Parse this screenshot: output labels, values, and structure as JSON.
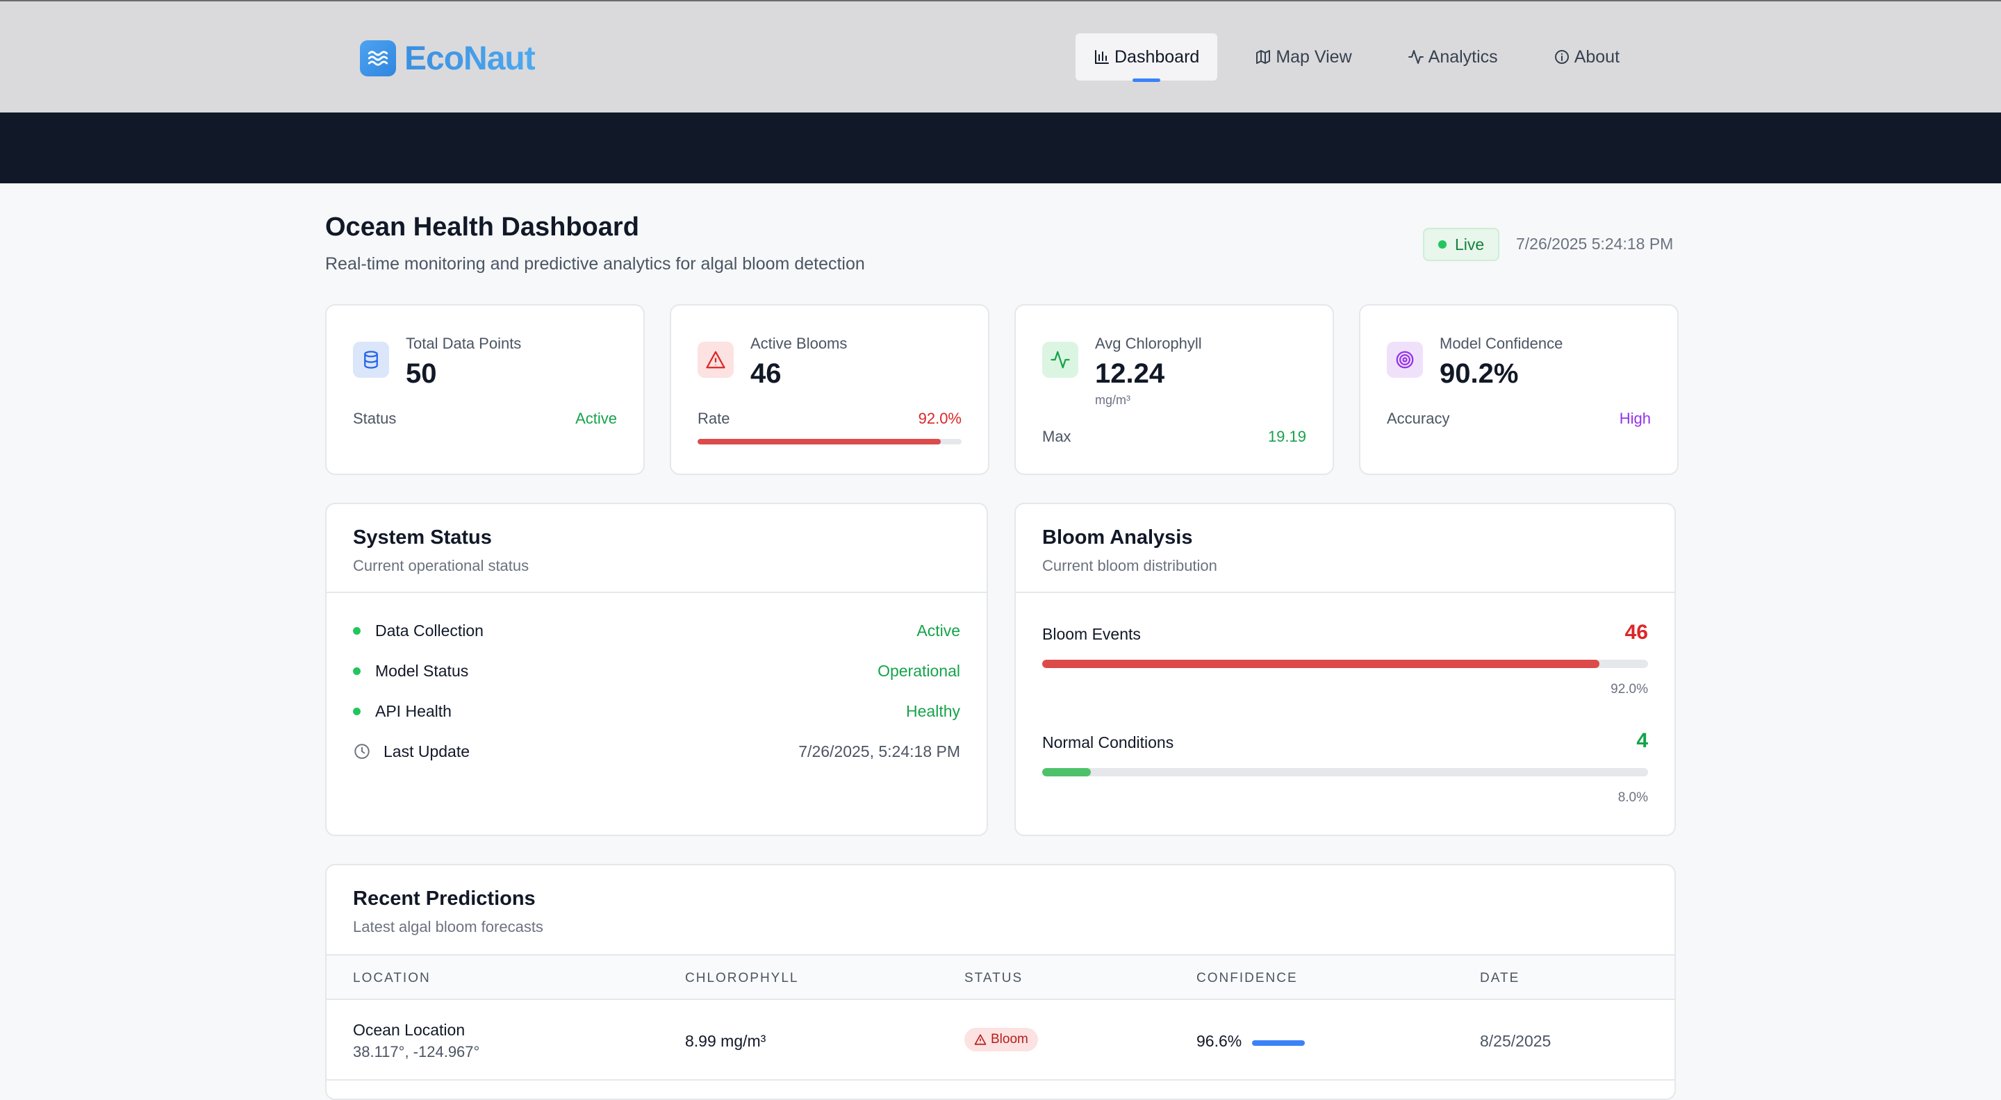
{
  "app": {
    "name": "EcoNaut"
  },
  "nav": {
    "items": [
      {
        "label": "Dashboard",
        "icon": "bar-chart-icon",
        "active": true
      },
      {
        "label": "Map View",
        "icon": "map-icon",
        "active": false
      },
      {
        "label": "Analytics",
        "icon": "activity-icon",
        "active": false
      },
      {
        "label": "About",
        "icon": "info-icon",
        "active": false
      }
    ]
  },
  "header": {
    "title": "Ocean Health Dashboard",
    "subtitle": "Real-time monitoring and predictive analytics for algal bloom detection",
    "live_label": "Live",
    "timestamp": "7/26/2025 5:24:18 PM"
  },
  "stats": [
    {
      "label": "Total Data Points",
      "value": "50",
      "foot_label": "Status",
      "foot_value": "Active",
      "icon": "database-icon"
    },
    {
      "label": "Active Blooms",
      "value": "46",
      "foot_label": "Rate",
      "foot_value": "92.0%",
      "progress": 0.92,
      "icon": "warning-icon"
    },
    {
      "label": "Avg Chlorophyll",
      "value": "12.24",
      "unit": "mg/m³",
      "foot_label": "Max",
      "foot_value": "19.19",
      "icon": "activity-icon"
    },
    {
      "label": "Model Confidence",
      "value": "90.2%",
      "foot_label": "Accuracy",
      "foot_value": "High",
      "icon": "target-icon"
    }
  ],
  "system_status": {
    "title": "System Status",
    "subtitle": "Current operational status",
    "rows": [
      {
        "name": "Data Collection",
        "value": "Active"
      },
      {
        "name": "Model Status",
        "value": "Operational"
      },
      {
        "name": "API Health",
        "value": "Healthy"
      },
      {
        "name": "Last Update",
        "value": "7/26/2025, 5:24:18 PM"
      }
    ]
  },
  "bloom_analysis": {
    "title": "Bloom Analysis",
    "subtitle": "Current bloom distribution",
    "rows": [
      {
        "label": "Bloom Events",
        "count": "46",
        "percent_label": "92.0%",
        "fraction": 0.92,
        "color": "#dc4a4a"
      },
      {
        "label": "Normal Conditions",
        "count": "4",
        "percent_label": "8.0%",
        "fraction": 0.08,
        "color": "#4ec26a"
      }
    ]
  },
  "predictions": {
    "title": "Recent Predictions",
    "subtitle": "Latest algal bloom forecasts",
    "columns": [
      "LOCATION",
      "CHLOROPHYLL",
      "STATUS",
      "CONFIDENCE",
      "DATE"
    ],
    "rows": [
      {
        "location": "Ocean Location",
        "coords": "38.117°, -124.967°",
        "chlorophyll": "8.99 mg/m³",
        "status": "Bloom",
        "confidence": "96.6%",
        "confidence_fraction": 0.966,
        "date": "8/25/2025"
      }
    ]
  },
  "colors": {
    "accent": "#3b82f6",
    "danger": "#dc4a4a",
    "success": "#16a34a",
    "purple": "#9333ea"
  }
}
